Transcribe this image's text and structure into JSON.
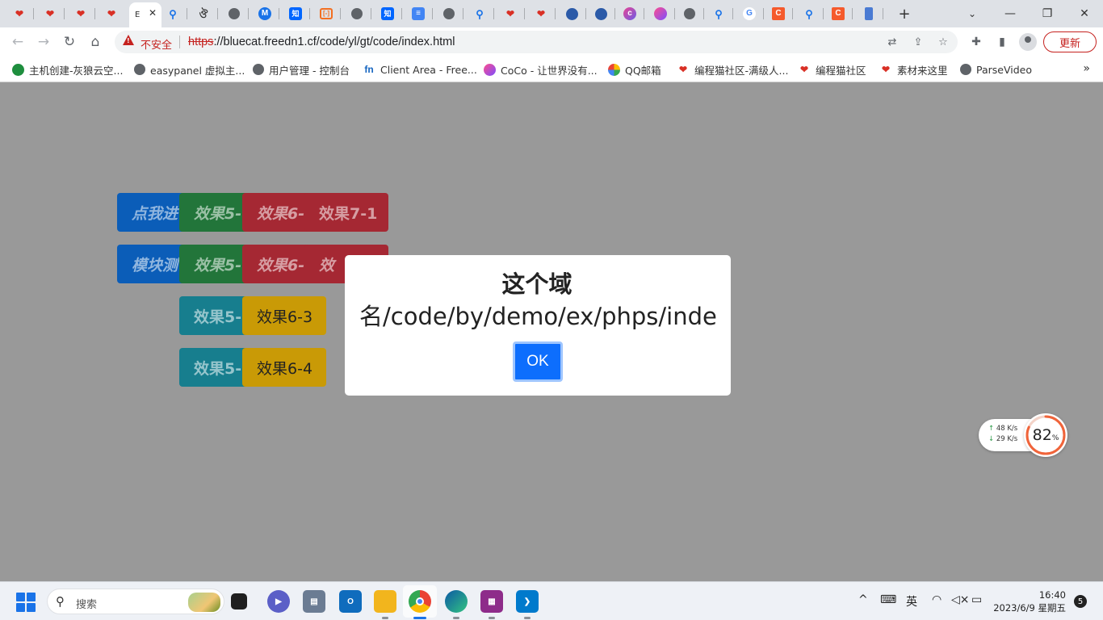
{
  "browser": {
    "active_tab_label": "E",
    "url_scheme": "https",
    "url_rest": "://bluecat.freedn1.cf/code/yl/gt/code/index.html",
    "security_label": "不安全",
    "update_label": "更新",
    "bookmarks": [
      {
        "label": "主机创建-灰狼云空...",
        "icon": "cloud-icon"
      },
      {
        "label": "easypanel 虚拟主...",
        "icon": "globe-icon"
      },
      {
        "label": "用户管理 - 控制台",
        "icon": "globe-icon"
      },
      {
        "label": "Client Area - Free...",
        "icon": "fn-icon"
      },
      {
        "label": "CoCo - 让世界没有...",
        "icon": "coco-icon"
      },
      {
        "label": "QQ邮箱",
        "icon": "qqmail-icon"
      },
      {
        "label": "编程猫社区-满级人...",
        "icon": "codecat-icon"
      },
      {
        "label": "编程猫社区",
        "icon": "codecat-icon"
      },
      {
        "label": "素材来这里",
        "icon": "codecat-icon"
      },
      {
        "label": "ParseVideo",
        "icon": "globe-icon"
      }
    ],
    "tab_glyphs": {
      "zhi": "知",
      "bracket": "[-]",
      "cocoa": "c",
      "g": "G",
      "c": "C",
      "m": "M"
    }
  },
  "page": {
    "buttons": {
      "row1": [
        "点我进",
        "效果5-",
        "效果6-",
        "效果7-1"
      ],
      "row2": [
        "模块测",
        "效果5-.",
        "效果6-:",
        "效"
      ],
      "row3": [
        "效果5-",
        "效果6-3"
      ],
      "row4": [
        "效果5-",
        "效果6-4"
      ]
    },
    "dialog": {
      "message_line1": "这个域",
      "message_line2": "名/code/by/demo/ex/phps/inde",
      "ok_label": "OK"
    }
  },
  "speed_widget": {
    "up_speed": "48",
    "down_speed": "29",
    "unit": "K/s",
    "percent": "82",
    "percent_sign": "%",
    "percent_value": 0.82
  },
  "taskbar": {
    "search_placeholder": "搜索",
    "ime_label": "英",
    "time": "16:40",
    "date": "2023/6/9 星期五",
    "notifications": "5"
  },
  "colors": {
    "page_bg": "#999999",
    "blue_btn": "#0b5db8",
    "green_btn": "#22753a",
    "red_btn": "#a52833",
    "teal_btn": "#177e8e",
    "amber_btn": "#c99a06",
    "ok_btn": "#0d6efd"
  }
}
